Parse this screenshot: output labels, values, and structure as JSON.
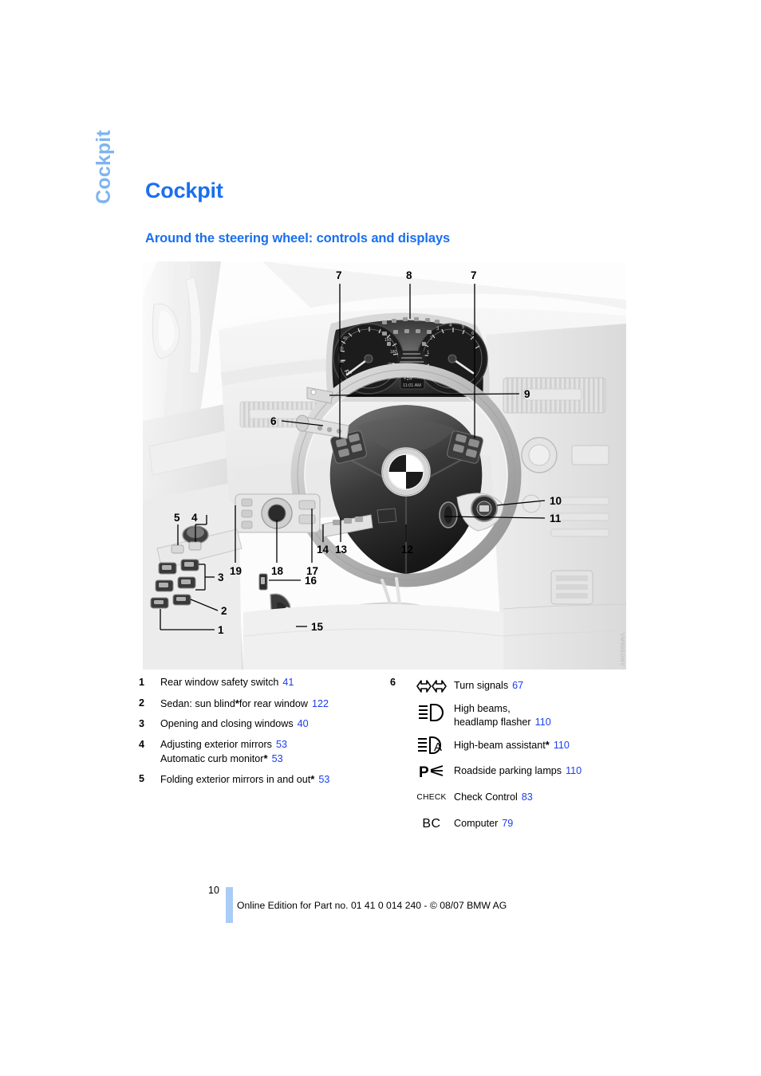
{
  "chapter_tab": "Cockpit",
  "page_title": "Cockpit",
  "section_heading": "Around the steering wheel: controls and displays",
  "illustration": {
    "image_code": "VM9BE0MV",
    "callouts": [
      "1",
      "2",
      "3",
      "4",
      "5",
      "6",
      "7",
      "8",
      "9",
      "10",
      "11",
      "12",
      "13",
      "14",
      "15",
      "16",
      "17",
      "18",
      "19"
    ]
  },
  "legend_left": [
    {
      "num": "1",
      "text": "Rear window safety switch",
      "page": "41"
    },
    {
      "num": "2",
      "text": "Sedan: sun blind",
      "asterisk": "*",
      "text_after": "for rear window",
      "page": "122"
    },
    {
      "num": "3",
      "text": "Opening and closing windows",
      "page": "40"
    },
    {
      "num": "4",
      "text": "Adjusting exterior mirrors",
      "page": "53",
      "sub_text": "Automatic curb monitor",
      "sub_asterisk": "*",
      "sub_page": "53"
    },
    {
      "num": "5",
      "text": "Folding exterior mirrors in and out",
      "asterisk": "*",
      "page": "53"
    }
  ],
  "legend_right": {
    "num": "6",
    "items": [
      {
        "icon": "turn-signals-icon",
        "label": "Turn signals",
        "page": "67"
      },
      {
        "icon": "high-beams-icon",
        "label_line1": "High beams,",
        "label_line2": "headlamp flasher",
        "page": "110"
      },
      {
        "icon": "high-beam-assistant-icon",
        "label": "High-beam assistant",
        "asterisk": "*",
        "page": "110"
      },
      {
        "icon": "roadside-parking-lamps-icon",
        "label": "Roadside parking lamps",
        "page": "110"
      },
      {
        "icon": "check-control-icon",
        "icon_text": "CHECK",
        "label": "Check Control",
        "page": "83"
      },
      {
        "icon": "computer-icon",
        "icon_text": "BC",
        "label": "Computer",
        "page": "79"
      }
    ]
  },
  "footer": {
    "page_number": "10",
    "text": "Online Edition for Part no. 01 41 0 014 240 - © 08/07 BMW AG"
  },
  "colors": {
    "heading_blue": "#1a6fee",
    "tab_blue": "#7fb4ef",
    "page_ref_blue": "#1a3df0",
    "footer_bar_blue": "#a9cdf4"
  }
}
